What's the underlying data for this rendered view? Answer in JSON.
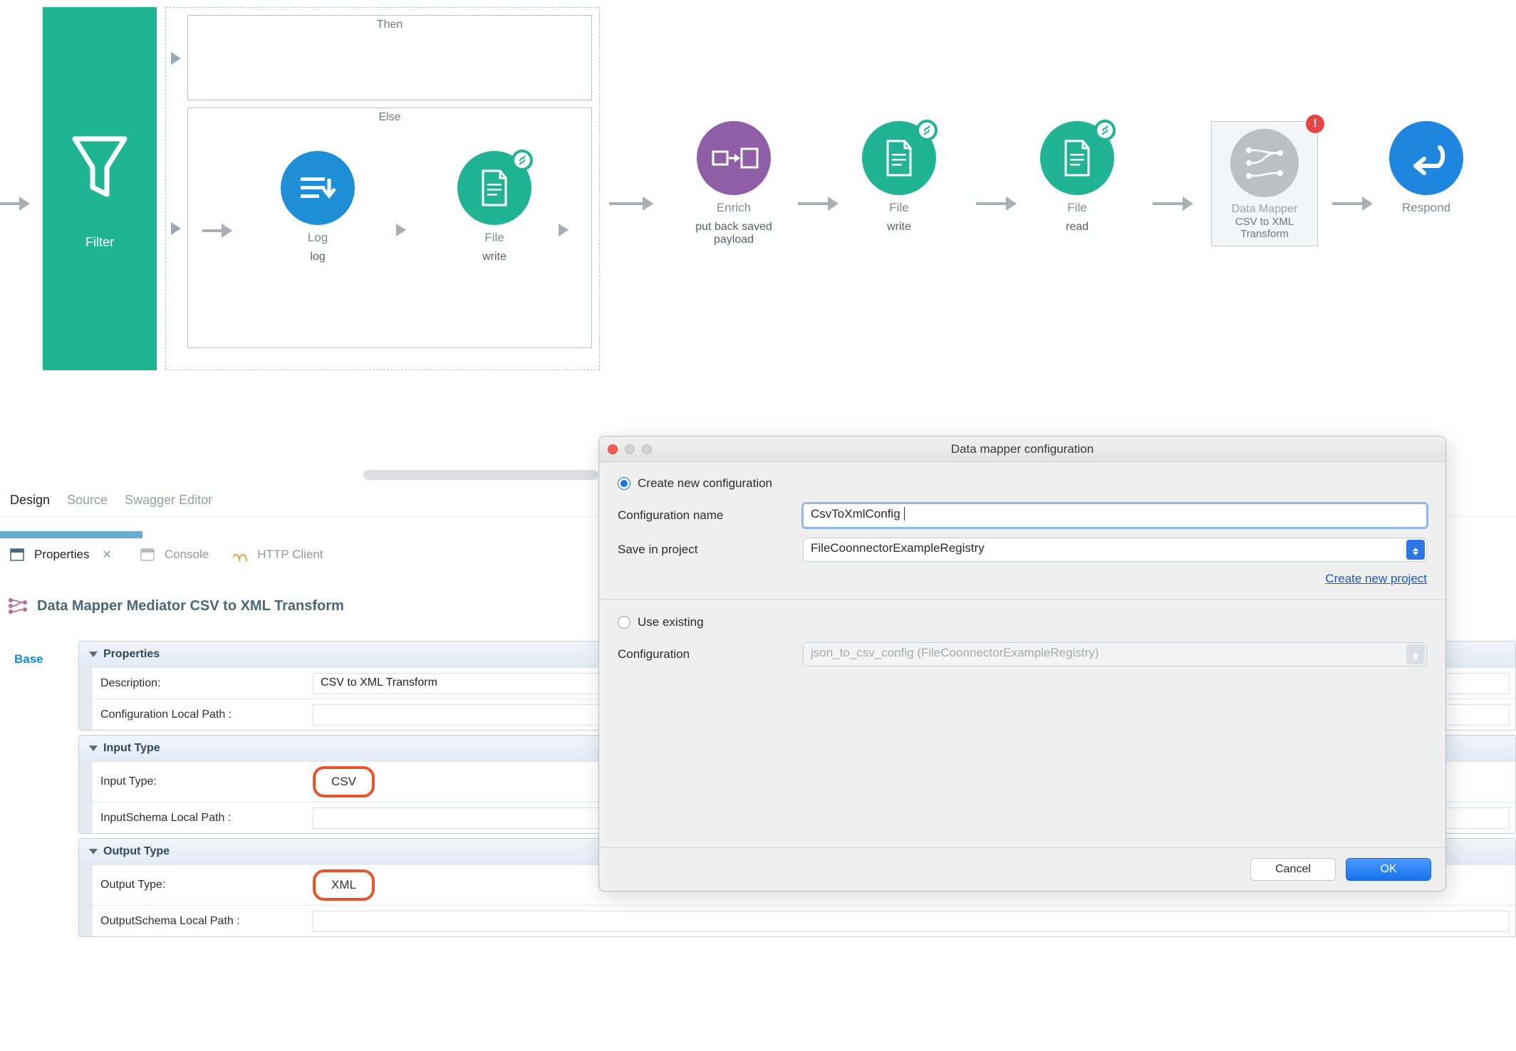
{
  "flow": {
    "filter": {
      "label": "Filter"
    },
    "branches": {
      "then": "Then",
      "else": "Else"
    },
    "nodes": {
      "log": {
        "title": "Log",
        "sub": "log"
      },
      "file1": {
        "title": "File",
        "sub": "write"
      },
      "enrich": {
        "title": "Enrich",
        "sub": "put back saved payload"
      },
      "file2": {
        "title": "File",
        "sub": "write"
      },
      "file3": {
        "title": "File",
        "sub": "read"
      },
      "datamapper": {
        "title": "Data Mapper",
        "sub": "CSV to XML Transform"
      },
      "respond": {
        "title": "Respond",
        "sub": ""
      }
    }
  },
  "editorTabs": {
    "design": "Design",
    "source": "Source",
    "swagger": "Swagger Editor"
  },
  "views": {
    "properties": "Properties",
    "console": "Console",
    "http": "HTTP Client"
  },
  "panelHeader": "Data Mapper Mediator CSV to XML Transform",
  "sideTab": "Base",
  "sections": {
    "properties": {
      "title": "Properties",
      "description": {
        "label": "Description:",
        "value": "CSV to XML Transform"
      },
      "configPath": {
        "label": "Configuration Local Path :",
        "value": ""
      }
    },
    "inputType": {
      "title": "Input Type",
      "inputType": {
        "label": "Input Type:",
        "value": "CSV"
      },
      "inputSchema": {
        "label": "InputSchema Local Path :",
        "value": ""
      }
    },
    "outputType": {
      "title": "Output Type",
      "outputType": {
        "label": "Output Type:",
        "value": "XML"
      },
      "outputSchema": {
        "label": "OutputSchema Local Path :",
        "value": ""
      }
    }
  },
  "dialog": {
    "title": "Data mapper configuration",
    "createNew": "Create new configuration",
    "useExisting": "Use existing",
    "configNameLabel": "Configuration name",
    "configNameValue": "CsvToXmlConfig",
    "saveInProjectLabel": "Save in project",
    "saveInProjectValue": "FileCoonnectorExampleRegistry",
    "createProjectLink": "Create new project",
    "configurationLabel": "Configuration",
    "configurationValue": "json_to_csv_config (FileCoonnectorExampleRegistry)",
    "cancel": "Cancel",
    "ok": "OK"
  }
}
